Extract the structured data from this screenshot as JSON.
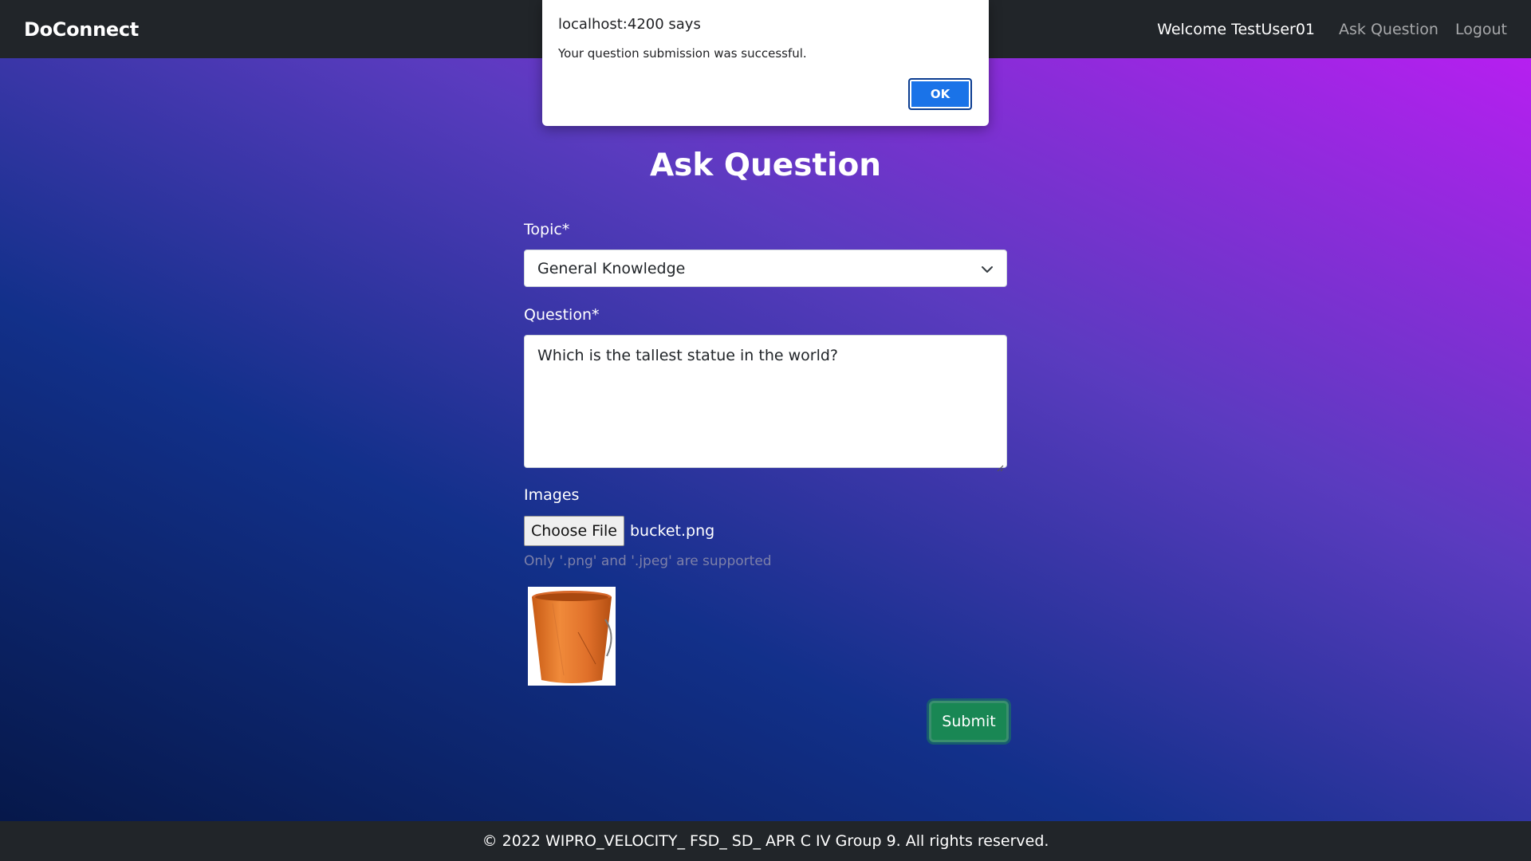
{
  "navbar": {
    "brand": "DoConnect",
    "welcome": "Welcome TestUser01",
    "links": {
      "ask_question": "Ask Question",
      "logout": "Logout"
    }
  },
  "form": {
    "title": "Ask Question",
    "topic_label": "Topic*",
    "topic_selected": "General Knowledge",
    "question_label": "Question*",
    "question_value": "Which is the tallest statue in the world?",
    "images_label": "Images",
    "choose_file_label": "Choose File",
    "file_name": "bucket.png",
    "file_hint": "Only '.png' and '.jpeg' are supported",
    "submit_label": "Submit"
  },
  "footer": {
    "text": "© 2022 WIPRO_VELOCITY_ FSD_ SD_ APR C IV Group 9. All rights reserved."
  },
  "dialog": {
    "title": "localhost:4200 says",
    "message": "Your question submission was successful.",
    "ok_label": "OK"
  },
  "icons": {
    "chevron": "chevron-down-icon",
    "resize": "resize-grip-icon",
    "preview": "bucket-image"
  },
  "colors": {
    "navbar_bg": "#212529",
    "submit_bg": "#198754",
    "ok_bg": "#1a73e8",
    "gradient_start": "#06184a",
    "gradient_end": "#b61ff0"
  }
}
